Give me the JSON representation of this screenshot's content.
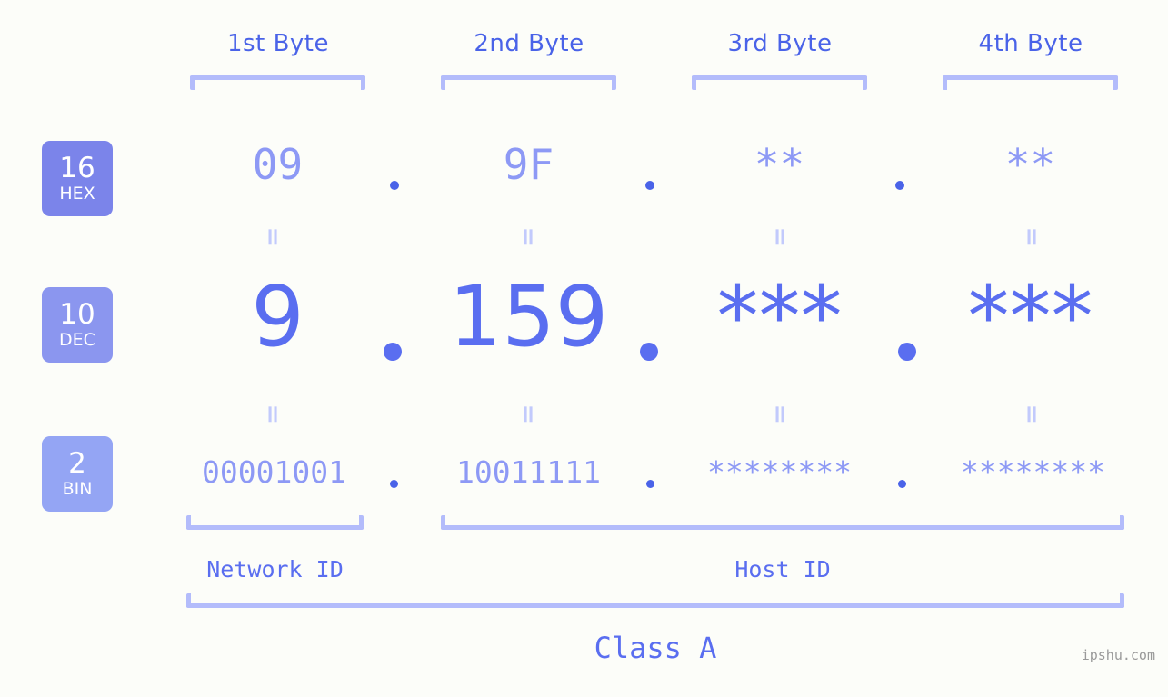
{
  "meta": {
    "watermark": "ipshu.com",
    "background_color": "#fcfdf9",
    "accent_color": "#4a63e8",
    "light_accent_color": "#8d99f5",
    "bracket_color": "#b3bcfb"
  },
  "byte_headers": [
    {
      "label": "1st Byte"
    },
    {
      "label": "2nd Byte"
    },
    {
      "label": "3rd Byte"
    },
    {
      "label": "4th Byte"
    }
  ],
  "bases": [
    {
      "number": "16",
      "name": "HEX",
      "color": "#7b84ea"
    },
    {
      "number": "10",
      "name": "DEC",
      "color": "#8b96ef"
    },
    {
      "number": "2",
      "name": "BIN",
      "color": "#94a5f4"
    }
  ],
  "rows": {
    "hex": {
      "values": [
        "09",
        "9F",
        "**",
        "**"
      ],
      "separator": "."
    },
    "dec": {
      "values": [
        "9",
        "159",
        "***",
        "***"
      ],
      "separator": "."
    },
    "bin": {
      "values": [
        "00001001",
        "10011111",
        "********",
        "********"
      ],
      "separator": "."
    }
  },
  "equals_marks": {
    "glyph": "=",
    "count_per_gap": 4,
    "gaps": 2
  },
  "id_sections": [
    {
      "label": "Network ID"
    },
    {
      "label": "Host ID"
    }
  ],
  "class": {
    "label": "Class A"
  }
}
